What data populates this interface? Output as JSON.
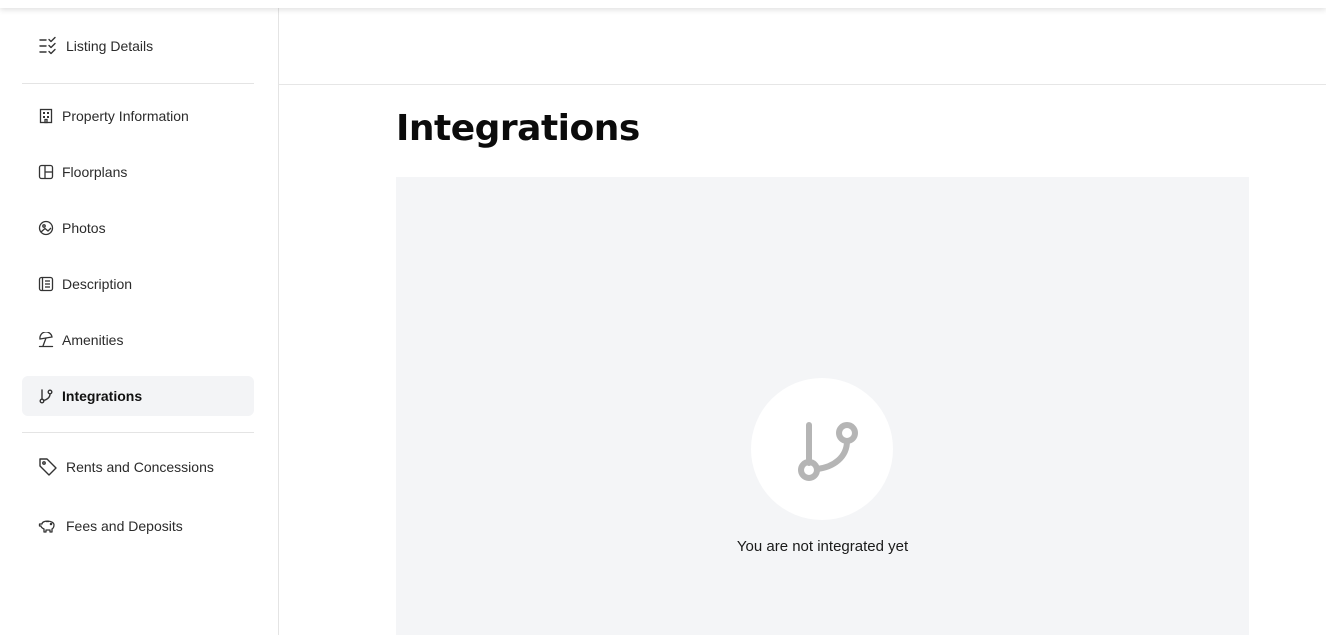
{
  "sidebar": {
    "items": [
      {
        "label": "Listing Details",
        "icon": "checklist-icon"
      },
      {
        "label": "Property Information",
        "icon": "building-icon"
      },
      {
        "label": "Floorplans",
        "icon": "floorplan-icon"
      },
      {
        "label": "Photos",
        "icon": "photo-icon"
      },
      {
        "label": "Description",
        "icon": "document-icon"
      },
      {
        "label": "Amenities",
        "icon": "umbrella-icon"
      },
      {
        "label": "Integrations",
        "icon": "git-branch-icon",
        "active": true
      },
      {
        "label": "Rents and Concessions",
        "icon": "tag-icon"
      },
      {
        "label": "Fees and Deposits",
        "icon": "piggy-bank-icon"
      }
    ]
  },
  "main": {
    "title": "Integrations",
    "empty_state": {
      "icon": "git-branch-icon",
      "message": "You are not integrated yet"
    }
  },
  "colors": {
    "active_bg": "#f3f4f6",
    "panel_bg": "#f4f5f7",
    "icon_gray": "#b5b5b5"
  }
}
